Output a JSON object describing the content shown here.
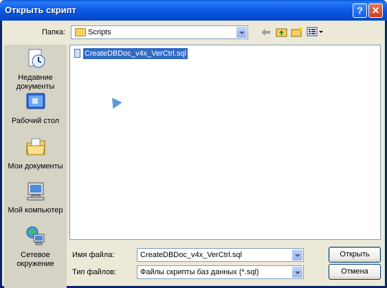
{
  "window": {
    "title": "Открыть скрипт"
  },
  "titlebar": {
    "help_symbol": "?",
    "close_symbol": "✕"
  },
  "location": {
    "label": "Папка:",
    "value": "Scripts"
  },
  "toolbar": {
    "back_icon": "back-arrow-icon",
    "up_icon": "up-folder-icon",
    "new_folder_icon": "new-folder-icon",
    "view_menu_icon": "view-menu-icon"
  },
  "places": [
    {
      "label": "Недавние документы"
    },
    {
      "label": "Рабочий стол"
    },
    {
      "label": "Мои документы"
    },
    {
      "label": "Мой компьютер"
    },
    {
      "label": "Сетевое окружение"
    }
  ],
  "files": [
    {
      "name": "CreateDBDoc_v4x_VerCtrl.sql",
      "selected": true
    }
  ],
  "filename": {
    "label": "Имя файла:",
    "value": "CreateDBDoc_v4x_VerCtrl.sql"
  },
  "filetype": {
    "label": "Тип файлов:",
    "value": "Файлы скрипты баз данных (*.sql)"
  },
  "buttons": {
    "open": "Открыть",
    "cancel": "Отмена"
  },
  "colors": {
    "titlebar": "#0b5ae0",
    "dialog_bg": "#ece9d8",
    "selection": "#316ac5"
  }
}
